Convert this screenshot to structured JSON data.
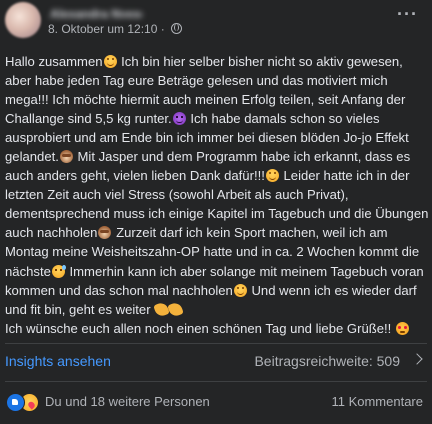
{
  "post": {
    "author": "Alexandra Nyeső",
    "timestamp": "8. Oktober um 12:10",
    "separator": "·",
    "privacy_icon": "globe-icon",
    "more_icon": "more-options-icon",
    "text_lines": [
      "Hallo zusammen",
      " Ich bin hier selber bisher nicht so aktiv gewesen, aber habe jeden Tag eure Beträge gelesen und das motiviert mich mega!!! Ich möchte hiermit auch meinen Erfolg teilen, seit Anfang der Challange sind 5,5 kg runter.",
      " Ich habe damals schon so vieles ausprobiert und am Ende bin ich immer bei diesen blöden Jo-jo Effekt gelandet.",
      " Mit Jasper und dem Programm habe ich erkannt, dass es auch anders geht, vielen lieben Dank dafür!!!",
      " Leider hatte ich in der letzten Zeit auch viel Stress (sowohl Arbeit als auch Privat), dementsprechend muss ich einige Kapitel im Tagebuch und die Übungen auch nachholen",
      " Zurzeit darf ich kein Sport machen, weil ich am Montag meine Weisheitszahn-OP hatte und in ca. 2 Wochen kommt die nächste",
      " Immerhin kann ich aber solange mit meinem Tagebuch voran kommen und das schon mal nachholen",
      " Und wenn ich es wieder darf und fit bin, geht es weiter ",
      "Ich wünsche euch allen noch einen schönen Tag und liebe Grüße!!"
    ]
  },
  "insights": {
    "link_label": "Insights ansehen",
    "reach_label": "Beitragsreichweite: 509",
    "chevron_icon": "chevron-right-icon"
  },
  "reactions": {
    "icons": [
      "like-icon",
      "care-icon"
    ],
    "summary": "Du und 18 weitere Personen",
    "comments": "11 Kommentare"
  },
  "colors": {
    "background": "#242526",
    "text": "#e4e6eb",
    "muted": "#b0b3b8",
    "link": "#4599ff",
    "like": "#1b74e4"
  }
}
